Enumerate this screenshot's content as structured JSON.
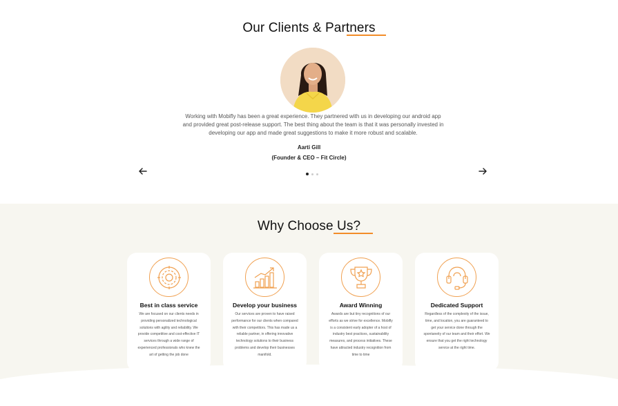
{
  "clients": {
    "title": "Our Clients & Partners",
    "testimonial": {
      "quote": "Working with Mobifly has been a great experience. They partnered with us in developing our android app and provided great post-release support. The best thing about the team is that it was personally invested in developing our app and made great suggestions to make it more robust and scalable.",
      "name": "Aarti Gill",
      "role": "(Founder & CEO – Fit Circle)"
    },
    "prev_icon": "arrow-left-icon",
    "next_icon": "arrow-right-icon",
    "slides": 3,
    "active_slide": 1
  },
  "why": {
    "title": "Why Choose Us?",
    "cards": [
      {
        "icon": "gear-icon",
        "title": "Best in class service",
        "text": "We are focused on our clients needs in providing personalized technological solutions with agility and reliability. We provide competitive and cost-effective IT services through a wide range of experienced professionals who knew the art of getting the job done"
      },
      {
        "icon": "growth-chart-icon",
        "title": "Develop your business",
        "text": "Our services are proven to have raised performance for our clients when compared with their competitors. This has made us a reliable partner, in offering innovative technology solutions to their business problems and develop their businesses manifold."
      },
      {
        "icon": "trophy-icon",
        "title": "Award Winning",
        "text": "Awards are but tiny recognitions of our efforts as we strive for excellence. Mobifly is a consistent early adopter of a host of industry best practices, sustainability measures, and process initiatives. These have attracted industry recognition from time to time"
      },
      {
        "icon": "headset-icon",
        "title": "Dedicated Support",
        "text": "Regardless of the complexity of the issue, time, and location, you are guaranteed to get your service done through the spontaneity of our team and their effort. We ensure that you get the right technology service at the right time."
      }
    ]
  },
  "colors": {
    "accent": "#f28c28",
    "section_bg": "#f7f6f0",
    "avatar_bg": "#f2dcc4"
  }
}
